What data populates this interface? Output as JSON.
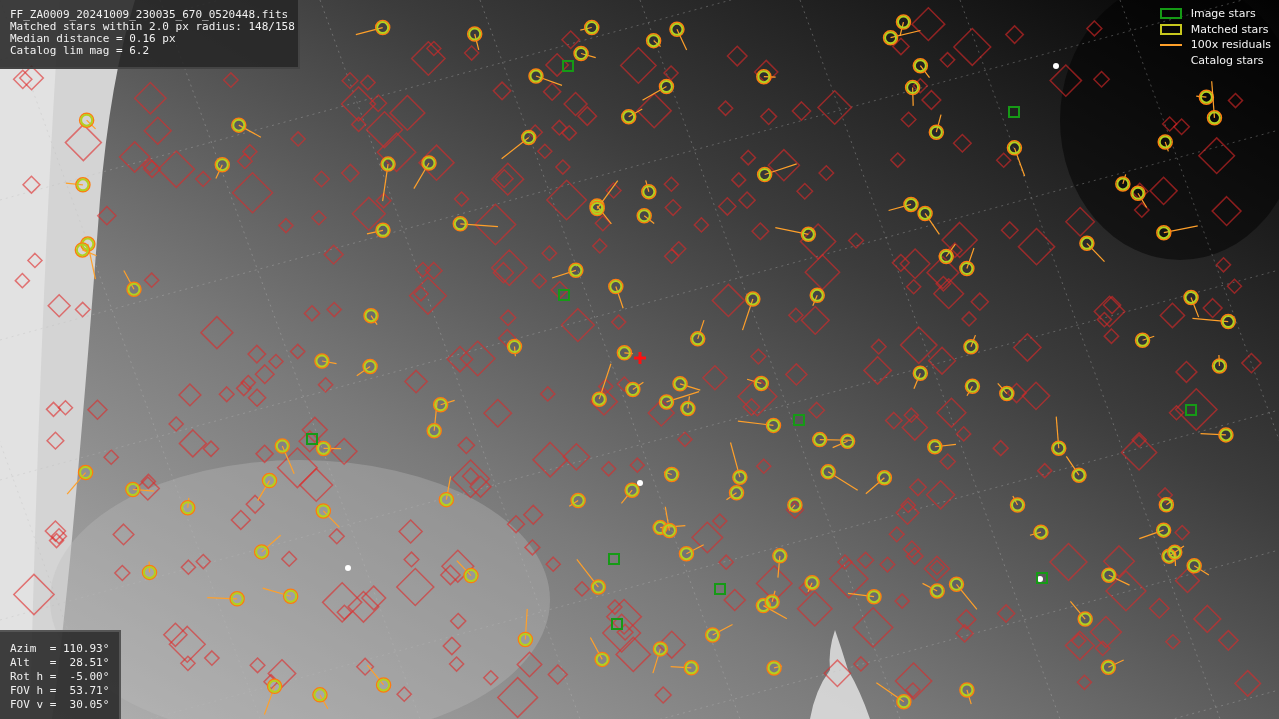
{
  "info_box": {
    "lines": [
      "FF_ZA0009_20241009_230035_670_0520448.fits",
      "Matched stars within 2.0 px radius: 148/158",
      "Median distance = 0.16 px",
      "Catalog lim mag = 6.2"
    ]
  },
  "legend": {
    "items": [
      {
        "label": "Image stars",
        "kind": "box",
        "color": "#159a15"
      },
      {
        "label": "Matched stars",
        "kind": "box",
        "color": "#c8c81e"
      },
      {
        "label": "100x residuals",
        "kind": "line",
        "color": "#ffa02a"
      },
      {
        "label": "Catalog stars",
        "kind": "none"
      }
    ]
  },
  "pointing_box": {
    "lines": [
      "Azim  = 110.93°",
      "Alt   =  28.51°",
      "Rot h =  -5.00°",
      "FOV h =  53.71°",
      "FOV v =  30.05°"
    ]
  }
}
